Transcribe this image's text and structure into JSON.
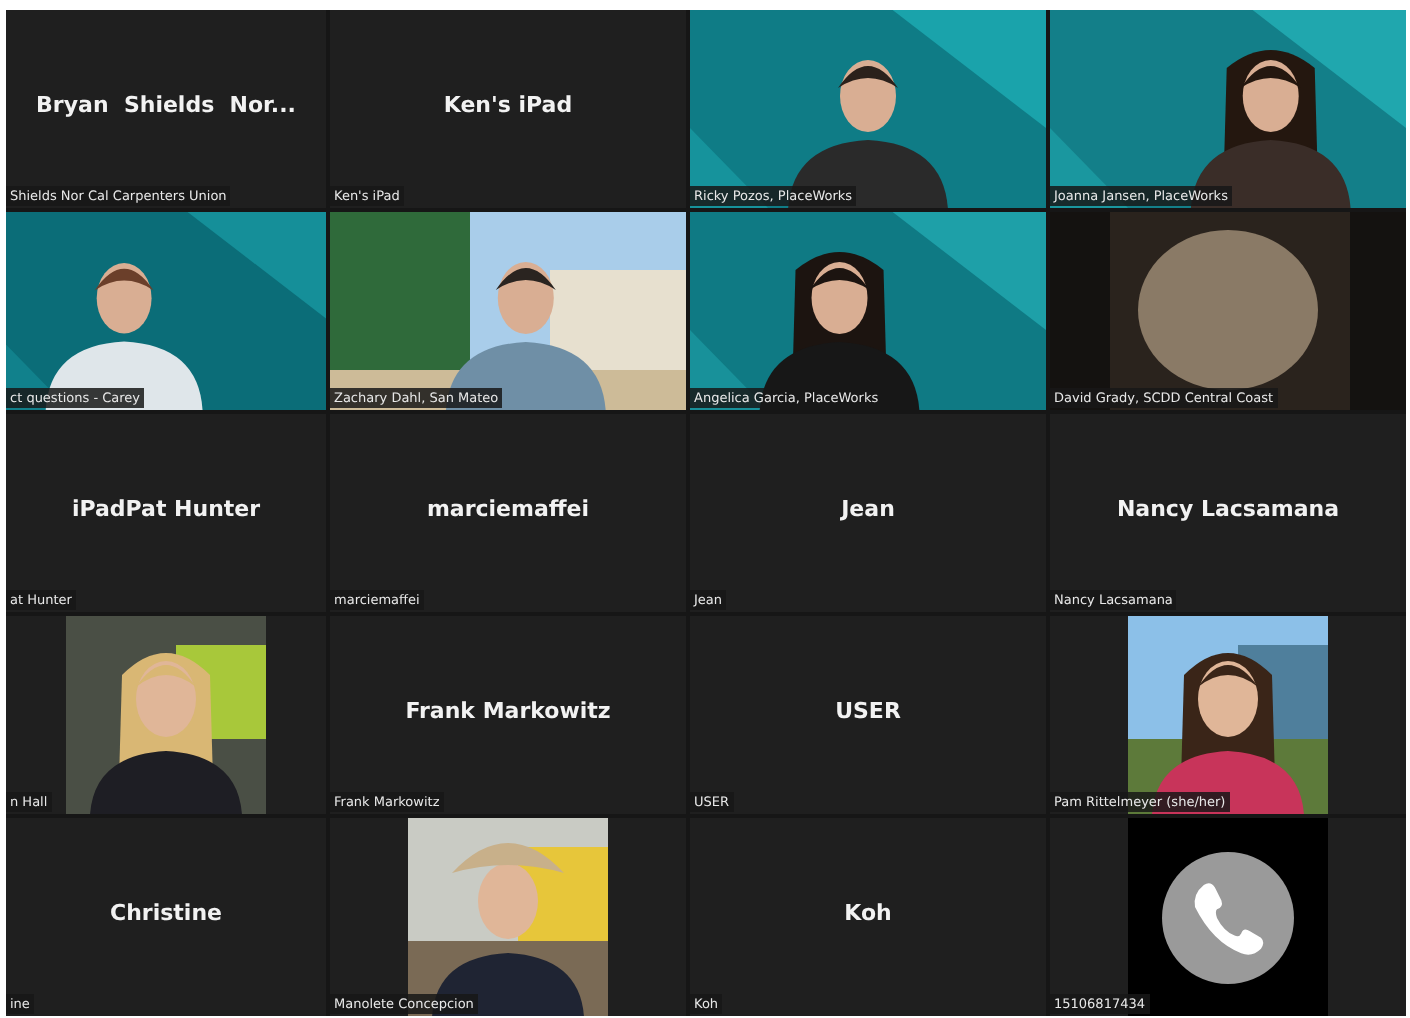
{
  "tiles": [
    {
      "kind": "name",
      "display_name": "Bryan  Shields  Nor...",
      "label": "Shields Nor Cal Carpenters Union"
    },
    {
      "kind": "name",
      "display_name": "Ken's iPad",
      "label": "Ken's iPad"
    },
    {
      "kind": "video",
      "label": "Ricky Pozos, PlaceWorks"
    },
    {
      "kind": "video",
      "label": "Joanna Jansen, PlaceWorks"
    },
    {
      "kind": "video",
      "label": "ct questions - Carey"
    },
    {
      "kind": "video",
      "label": "Zachary Dahl, San Mateo"
    },
    {
      "kind": "video",
      "label": "Angelica Garcia, PlaceWorks"
    },
    {
      "kind": "video",
      "label": "David Grady, SCDD Central Coast"
    },
    {
      "kind": "name",
      "display_name": "iPadPat Hunter",
      "label": "at Hunter"
    },
    {
      "kind": "name",
      "display_name": "marciemaffei",
      "label": "marciemaffei"
    },
    {
      "kind": "name",
      "display_name": "Jean",
      "label": "Jean"
    },
    {
      "kind": "name",
      "display_name": "Nancy Lacsamana",
      "label": "Nancy Lacsamana"
    },
    {
      "kind": "portrait",
      "label": "n Hall"
    },
    {
      "kind": "name",
      "display_name": "Frank Markowitz",
      "label": "Frank Markowitz"
    },
    {
      "kind": "name",
      "display_name": "USER",
      "label": "USER"
    },
    {
      "kind": "portrait",
      "label": "Pam Rittelmeyer (she/her)"
    },
    {
      "kind": "name",
      "display_name": "Christine",
      "label": "ine"
    },
    {
      "kind": "portrait",
      "label": "Manolete Concepcion"
    },
    {
      "kind": "name",
      "display_name": "Koh",
      "label": "Koh"
    },
    {
      "kind": "phone",
      "label": "15106817434"
    }
  ]
}
